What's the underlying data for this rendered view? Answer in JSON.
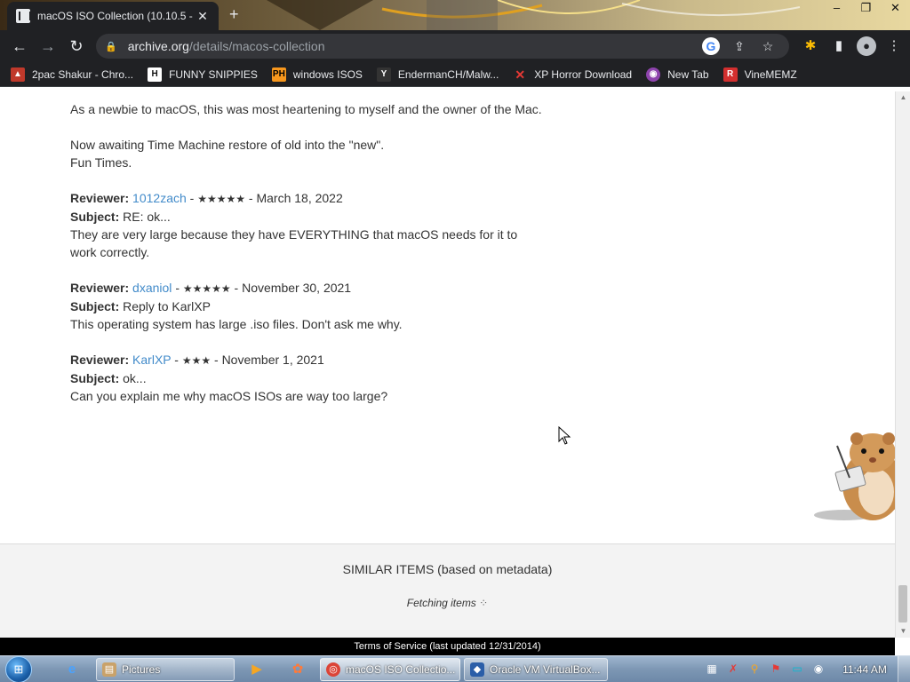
{
  "browser": {
    "tab_title": "macOS ISO Collection (10.10.5 -",
    "tab_close": "✕",
    "new_tab": "+",
    "url_host": "archive.org",
    "url_path": "/details/macos-collection"
  },
  "bookmarks": [
    {
      "label": "2pac Shakur - Chro...",
      "icon": "photo-icon",
      "color": "#c0392b"
    },
    {
      "label": "FUNNY SNIPPIES",
      "icon": "h-logo-icon",
      "color": "#ffffff"
    },
    {
      "label": "windows ISOS",
      "icon": "ph-logo-icon",
      "color": "#f7971d"
    },
    {
      "label": "EndermanCH/Malw...",
      "icon": "yp-logo-icon",
      "color": "#333333"
    },
    {
      "label": "XP Horror Download",
      "icon": "x-logo-icon",
      "color": "#e53935"
    },
    {
      "label": "New Tab",
      "icon": "globe-icon",
      "color": "#8e44ad"
    },
    {
      "label": "VineMEMZ",
      "icon": "r-logo-icon",
      "color": "#d32f2f"
    }
  ],
  "reviews_intro": {
    "line1": "As a newbie to macOS, this was most heartening to myself and the owner of the Mac.",
    "line2": "Now awaiting Time Machine restore of old into the \"new\".",
    "line3": "Fun Times."
  },
  "labels": {
    "reviewer": "Reviewer:",
    "subject": "Subject:"
  },
  "reviews": [
    {
      "reviewer": "1012zach",
      "stars": "★★★★★",
      "date": "March 18, 2022",
      "subject": "RE: ok...",
      "body": "They are very large because they have EVERYTHING that macOS needs for it to work correctly.",
      "rating": 5
    },
    {
      "reviewer": "dxaniol",
      "stars": "★★★★★",
      "date": "November 30, 2021",
      "subject": "Reply to KarlXP",
      "body": "This operating system has large .iso files. Don't ask me why.",
      "rating": 5
    },
    {
      "reviewer": "KarlXP",
      "stars": "★★★",
      "date": "November 1, 2021",
      "subject": "ok...",
      "body": "Can you explain me why macOS ISOs are way too large?",
      "rating": 3
    }
  ],
  "similar": {
    "title": "SIMILAR ITEMS (based on metadata)",
    "fetching": "Fetching items"
  },
  "footer": {
    "terms": "Terms of Service (last updated 12/31/2014)"
  },
  "taskbar": {
    "pictures": "Pictures",
    "chrome_window": "macOS ISO Collectio...",
    "virtualbox_window": "Oracle VM VirtualBox...",
    "clock": "11:44 AM"
  }
}
